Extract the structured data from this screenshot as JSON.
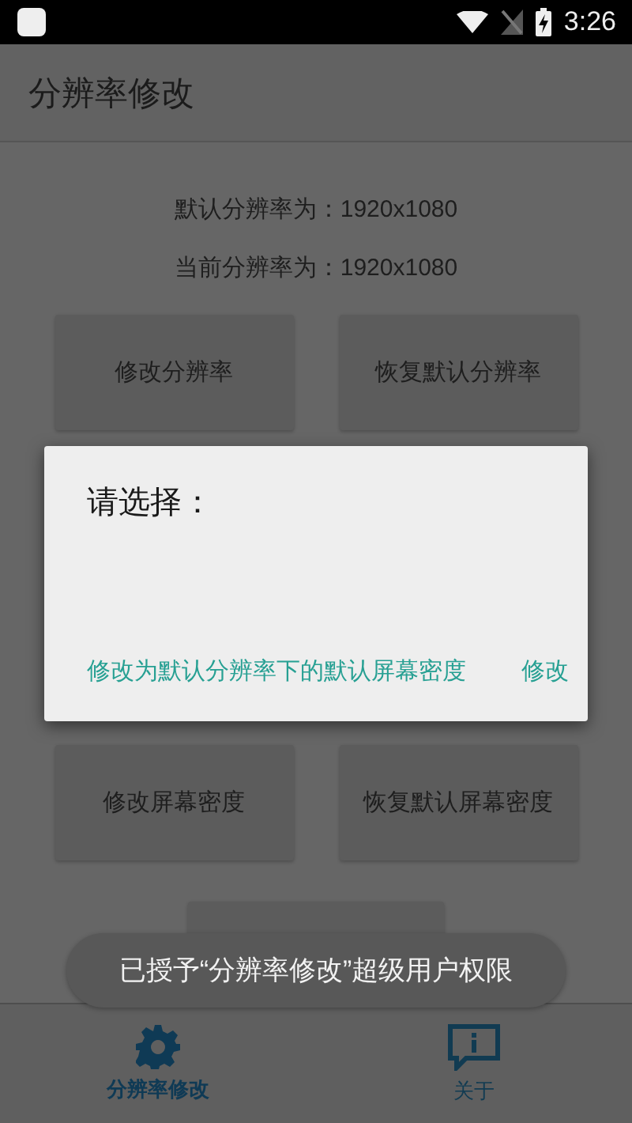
{
  "status_bar": {
    "time": "3:26"
  },
  "app_bar": {
    "title": "分辨率修改"
  },
  "info": [
    "默认分辨率为：1920x1080",
    "当前分辨率为：1920x1080"
  ],
  "buttons": [
    {
      "label": "修改分辨率"
    },
    {
      "label": "恢复默认分辨率"
    },
    {
      "label": "修改屏幕密度"
    },
    {
      "label": "恢复默认屏幕密度"
    }
  ],
  "dialog": {
    "title": "请选择：",
    "actions": [
      "修改为默认分辨率下的默认屏幕密度",
      "修改"
    ]
  },
  "toast": "已授予“分辨率修改”超级用户权限",
  "bottom_nav": [
    {
      "label": "分辨率修改",
      "kind": "gear",
      "selected": true
    },
    {
      "label": "关于",
      "kind": "info",
      "selected": false
    }
  ]
}
